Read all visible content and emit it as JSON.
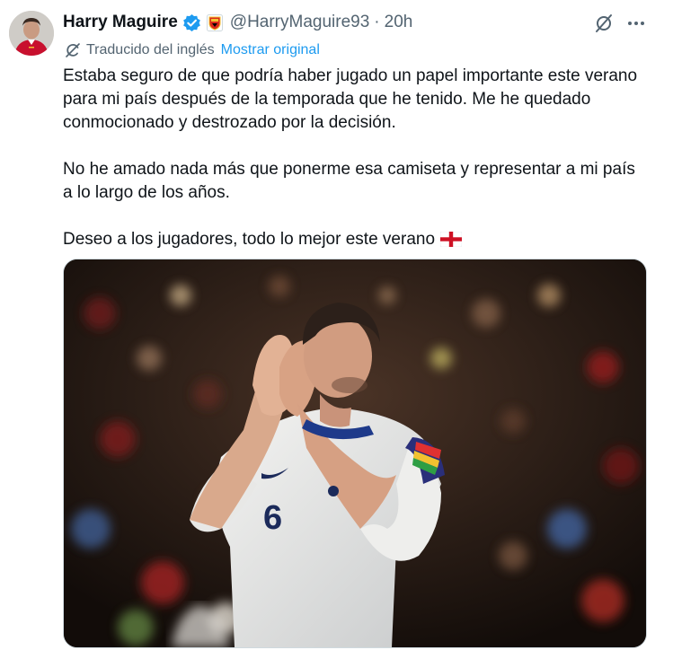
{
  "author": {
    "name": "Harry Maguire",
    "handle": "@HarryMaguire93",
    "separator": "·",
    "time": "20h"
  },
  "icons": {
    "avatar": "profile-photo",
    "verified": "verified-badge-icon",
    "club": "manchester-united-crest-icon",
    "grok": "grok-icon",
    "more": "more-options-icon",
    "translate": "translate-icon",
    "flag": "england-flag-emoji"
  },
  "translation": {
    "label": "Traducido del inglés",
    "link": "Mostrar original"
  },
  "tweet": {
    "paragraph1_line1": "Estaba seguro de que podría haber jugado un papel importante este verano",
    "paragraph1_line2": "para mi país después de la temporada que he tenido. Me he quedado",
    "paragraph1_line3": "conmocionado y destrozado por la decisión.",
    "paragraph2_line1": "No he amado nada más que ponerme esa camiseta y representar a mi país",
    "paragraph2_line2": "a lo largo de los años.",
    "paragraph3": "Deseo a los jugadores, todo lo mejor este verano"
  },
  "media": {
    "shirt_number": "6"
  },
  "colors": {
    "verified_blue": "#1d9bf0",
    "link_blue": "#1d9bf0",
    "secondary_text": "#536471",
    "primary_text": "#0f1419"
  }
}
